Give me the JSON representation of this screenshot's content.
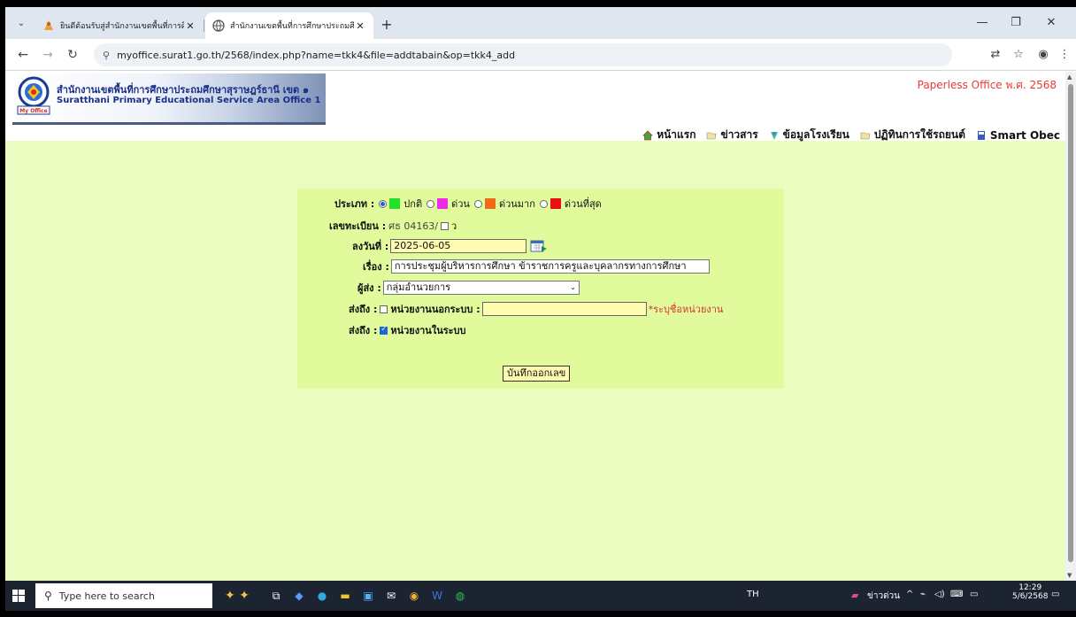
{
  "browser": {
    "tabs": [
      {
        "title": "ยินดีต้อนรับสู่สำนักงานเขตพื้นที่การศึ",
        "active": false
      },
      {
        "title": "สำนักงานเขตพื้นที่การศึกษาประถมศึ",
        "active": true
      }
    ],
    "url": "myoffice.surat1.go.th/2568/index.php?name=tkk4&file=addtabain&op=tkk4_add"
  },
  "site": {
    "title_th": "สำนักงานเขตพื้นที่การศึกษาประถมศึกษาสุราษฎร์ธานี เขต ๑",
    "title_en": "Suratthani Primary Educational Service Area Office 1",
    "logo_caption": "My Office",
    "tagline": "Paperless Office พ.ศ. 2568",
    "nav": [
      {
        "label": "หน้าแรก",
        "icon": "home-icon"
      },
      {
        "label": "ข่าวสาร",
        "icon": "news-icon"
      },
      {
        "label": "ข้อมูลโรงเรียน",
        "icon": "school-icon"
      },
      {
        "label": "ปฏิทินการใช้รถยนต์",
        "icon": "calendar-icon"
      },
      {
        "label": "Smart Obec",
        "icon": "book-icon"
      }
    ]
  },
  "form": {
    "type_label": "ประเภท :",
    "types": [
      {
        "label": "ปกติ",
        "color": "#22e02a",
        "checked": true
      },
      {
        "label": "ด่วน",
        "color": "#ee2ae6",
        "checked": false
      },
      {
        "label": "ด่วนมาก",
        "color": "#f06a1c",
        "checked": false
      },
      {
        "label": "ด่วนที่สุด",
        "color": "#e81010",
        "checked": false
      }
    ],
    "regno_label": "เลขทะเบียน :",
    "regno_value": "ศธ 04163/",
    "regno_suffix": "ว",
    "date_label": "ลงวันที่ :",
    "date_value": "2025-06-05",
    "subject_label": "เรื่อง :",
    "subject_value": "การประชุมผู้บริหารการศึกษา ข้าราชการครูและบุคลากรทางการศึกษา",
    "sender_label": "ผู้ส่ง :",
    "sender_value": "กลุ่มอำนวยการ",
    "to_external_label": "ส่งถึง :",
    "to_external_option": "หน่วยงานนอกระบบ :",
    "to_external_hint": "*ระบุชื่อหน่วยงาน",
    "to_internal_label": "ส่งถึง :",
    "to_internal_option": "หน่วยงานในระบบ",
    "submit_label": "บันทึกออกเลข"
  },
  "taskbar": {
    "search_placeholder": "Type here to search",
    "lang": "TH",
    "news": "ข่าวด่วน",
    "time": "12:29",
    "date": "5/6/2568"
  }
}
